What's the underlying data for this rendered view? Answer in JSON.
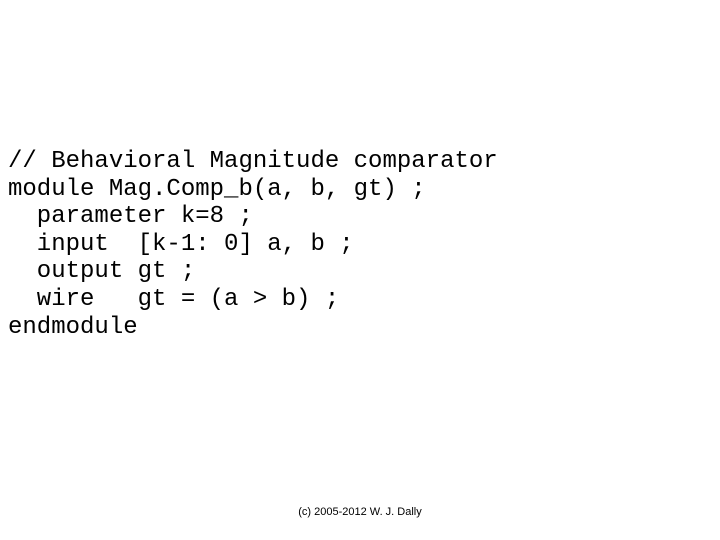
{
  "code": {
    "line1": "// Behavioral Magnitude comparator",
    "line2": "module Mag.Comp_b(a, b, gt) ;",
    "line3": "  parameter k=8 ;",
    "line4": "  input  [k-1: 0] a, b ;",
    "line5": "  output gt ;",
    "line6": "  wire   gt = (a > b) ;",
    "line7": "endmodule"
  },
  "footer": "(c) 2005-2012 W. J. Dally"
}
